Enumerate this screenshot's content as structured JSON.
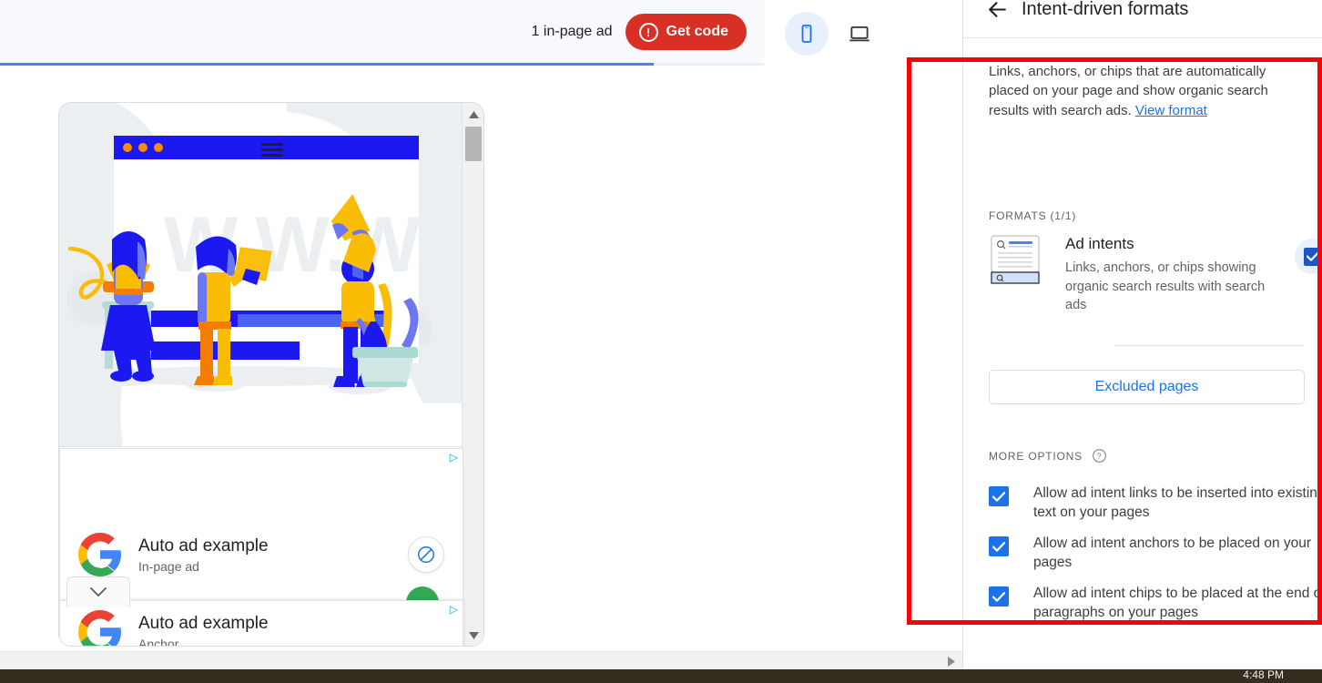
{
  "topbar": {
    "inpage_count": "1 in-page ad",
    "get_code_label": "Get code",
    "warning_glyph": "!",
    "mobile_icon": "mobile-device-icon",
    "desktop_icon": "desktop-device-icon",
    "progress_percent": 85
  },
  "preview": {
    "illustration_name": "website-people-illustration",
    "browser_dots": [
      "orange",
      "orange",
      "orange"
    ],
    "watermark_text": "W.W.W",
    "ads": [
      {
        "title": "Auto ad example",
        "subtitle": "In-page ad",
        "adchoices_icon": "adchoices-icon",
        "block_icon": "block-ad-icon"
      },
      {
        "title": "Auto ad example",
        "subtitle": "Anchor",
        "adchoices_icon": "adchoices-icon"
      }
    ],
    "collapse_icon": "chevron-down-icon",
    "scrollbar_up_icon": "scroll-up-arrow-icon",
    "scrollbar_down_icon": "scroll-down-arrow-icon",
    "hscroll_right_icon": "scroll-right-arrow-icon"
  },
  "panel": {
    "title": "Intent-driven formats",
    "back_icon": "back-arrow-icon",
    "description_lead": "Links, anchors, or chips that are automatically placed on your page and show organic search results with search ads.",
    "view_format_link": "View format",
    "formats_label": "FORMATS (1/1)",
    "format": {
      "thumb_icon": "ad-intents-thumbnail-icon",
      "name": "Ad intents",
      "description": "Links, anchors, or chips showing organic search results with search ads",
      "checked": true
    },
    "excluded_pages_label": "Excluded pages",
    "more_options_label": "MORE OPTIONS",
    "help_icon": "help-question-icon",
    "options": [
      {
        "label": "Allow ad intent links to be inserted into existing text on your pages",
        "checked": true
      },
      {
        "label": "Allow ad intent anchors to be placed on your pages",
        "checked": true
      },
      {
        "label": "Allow ad intent chips to be placed at the end of paragraphs on your pages",
        "checked": true
      }
    ]
  },
  "taskbar": {
    "clock": "4:48 PM"
  },
  "colors": {
    "accent_blue": "#1a73e8",
    "get_code_red": "#d93025",
    "annotation_red": "#fb0007",
    "checkbox_blue": "#1a56c4",
    "text_primary": "#202124",
    "text_secondary": "#5f6368"
  }
}
